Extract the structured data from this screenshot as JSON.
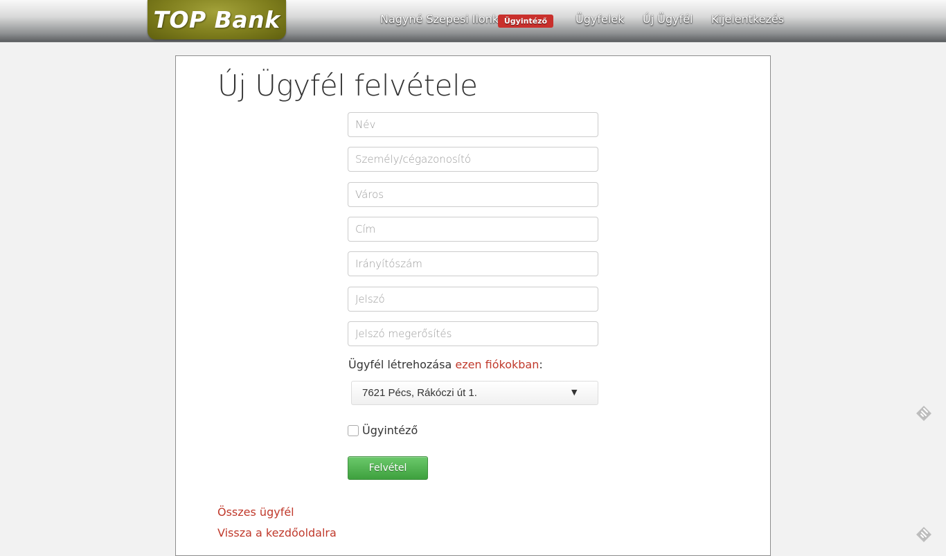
{
  "navbar": {
    "brand": "TOP Bank",
    "user_name": "Nagyné Szepesi Ilonka",
    "role_badge": "Ügyintéző",
    "clients_label": "Ügyfelek",
    "new_client_label": "Új Ügyfél",
    "logout_label": "Kijelentkezés"
  },
  "form": {
    "title": "Új Ügyfél felvétele",
    "fields": {
      "name": "Név",
      "id_number": "Személy/cégazonosító",
      "city": "Város",
      "address": "Cím",
      "zip": "Irányítószám",
      "password": "Jelszó",
      "password_confirm": "Jelszó megerősítés"
    },
    "branch_label_prefix": "Ügyfél létrehozása ",
    "branch_link": "ezen fiókokban",
    "branch_label_suffix": ":",
    "branch_selected": "7621 Pécs, Rákóczi út 1.",
    "select_arrow": "▼",
    "clerk_checkbox_label": "Ügyintéző",
    "clerk_checked": false,
    "submit_label": "Felvétel"
  },
  "links": {
    "all_clients": "Összes ügyfél",
    "back_home": "Vissza a kezdőoldalra"
  },
  "icons": {
    "side_top": "feedly-icon",
    "side_bottom": "feedly-icon"
  }
}
